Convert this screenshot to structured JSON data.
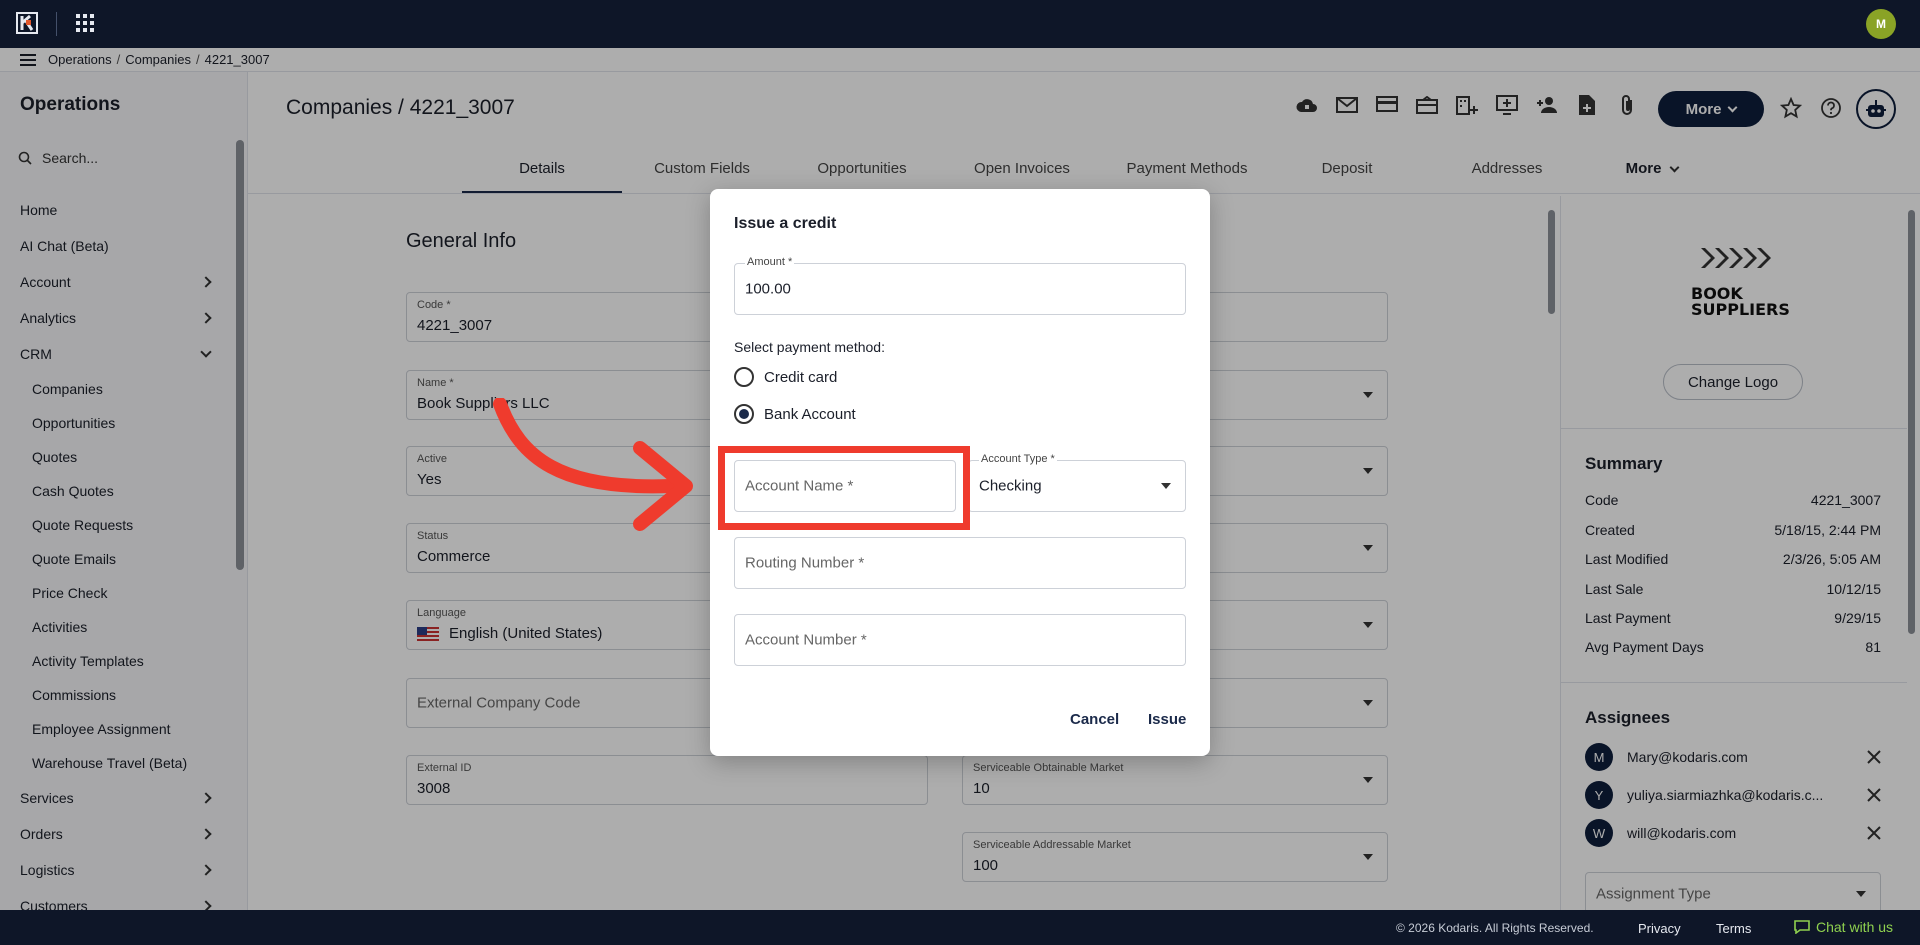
{
  "topbar": {
    "user_initial": "M"
  },
  "breadcrumb": [
    "Operations",
    "Companies",
    "4221_3007"
  ],
  "sidebar": {
    "title": "Operations",
    "search_placeholder": "Search...",
    "items": [
      {
        "label": "Home"
      },
      {
        "label": "AI Chat (Beta)"
      },
      {
        "label": "Account",
        "chevron": "right"
      },
      {
        "label": "Analytics",
        "chevron": "right"
      },
      {
        "label": "CRM",
        "chevron": "down"
      }
    ],
    "crm_subitems": [
      "Companies",
      "Opportunities",
      "Quotes",
      "Cash Quotes",
      "Quote Requests",
      "Quote Emails",
      "Price Check",
      "Activities",
      "Activity Templates",
      "Commissions",
      "Employee Assignment",
      "Warehouse Travel (Beta)"
    ],
    "bottom_items": [
      {
        "label": "Services"
      },
      {
        "label": "Orders"
      },
      {
        "label": "Logistics"
      },
      {
        "label": "Customers"
      }
    ]
  },
  "main": {
    "title": "Companies / 4221_3007",
    "more_label": "More",
    "tabs": [
      "Details",
      "Custom Fields",
      "Opportunities",
      "Open Invoices",
      "Payment Methods",
      "Deposit",
      "Addresses",
      "More"
    ],
    "section_title": "General Info",
    "fields": {
      "code_label": "Code *",
      "code_value": "4221_3007",
      "name_label": "Name *",
      "name_value": "Book Suppliers LLC",
      "active_label": "Active",
      "active_value": "Yes",
      "status_label": "Status",
      "status_value": "Commerce",
      "language_label": "Language",
      "language_value": "English (United States)",
      "external_code_placeholder": "External Company Code",
      "external_id_label": "External ID",
      "external_id_value": "3008",
      "sam_label": "Serviceable Obtainable Market",
      "sam_value": "10",
      "sam2_label": "Serviceable Addressable Market",
      "sam2_value": "100"
    }
  },
  "right_panel": {
    "logo_text_1": "BOOK",
    "logo_text_2": "SUPPLIERS",
    "change_logo": "Change Logo",
    "summary_title": "Summary",
    "summary": [
      {
        "k": "Code",
        "v": "4221_3007"
      },
      {
        "k": "Created",
        "v": "5/18/15, 2:44 PM"
      },
      {
        "k": "Last Modified",
        "v": "2/3/26, 5:05 AM"
      },
      {
        "k": "Last Sale",
        "v": "10/12/15"
      },
      {
        "k": "Last Payment",
        "v": "9/29/15"
      },
      {
        "k": "Avg Payment Days",
        "v": "81"
      }
    ],
    "assignees_title": "Assignees",
    "assignees": [
      {
        "initial": "M",
        "email": "Mary@kodaris.com"
      },
      {
        "initial": "Y",
        "email": "yuliya.siarmiazhka@kodaris.c..."
      },
      {
        "initial": "W",
        "email": "will@kodaris.com"
      }
    ],
    "assignment_type_placeholder": "Assignment Type"
  },
  "dialog": {
    "title": "Issue a credit",
    "amount_label": "Amount *",
    "amount_value": "100.00",
    "payment_method_label": "Select payment method:",
    "option_credit_card": "Credit card",
    "option_bank_account": "Bank Account",
    "selected_method": "Bank Account",
    "account_name_placeholder": "Account Name *",
    "account_type_label": "Account Type *",
    "account_type_value": "Checking",
    "routing_placeholder": "Routing Number *",
    "account_number_placeholder": "Account Number *",
    "cancel_label": "Cancel",
    "issue_label": "Issue"
  },
  "footer": {
    "copyright": "© 2026 Kodaris. All Rights Reserved.",
    "privacy": "Privacy",
    "terms": "Terms",
    "chat": "Chat with us"
  },
  "colors": {
    "topbar": "#0e1628",
    "accent": "#0e1e3c",
    "highlight": "#ef3b2d",
    "chat": "#8fd14f"
  }
}
